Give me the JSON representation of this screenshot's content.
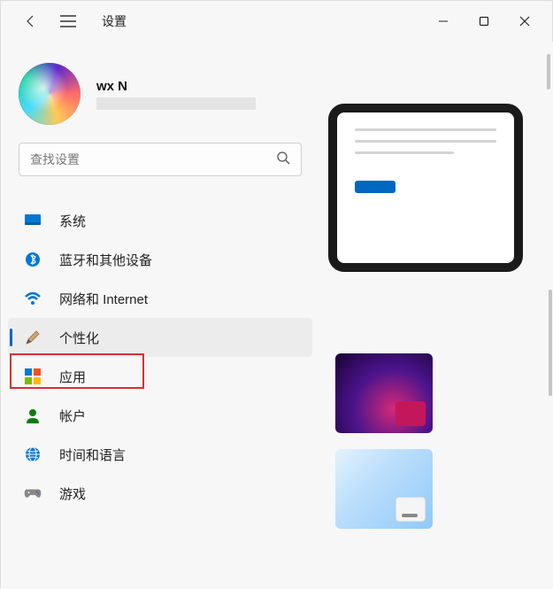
{
  "header": {
    "title": "设置"
  },
  "profile": {
    "name": "wx N"
  },
  "search": {
    "placeholder": "查找设置"
  },
  "nav": [
    {
      "id": "system",
      "label": "系统",
      "icon": "system-icon",
      "selected": false
    },
    {
      "id": "bluetooth",
      "label": "蓝牙和其他设备",
      "icon": "bluetooth-icon",
      "selected": false
    },
    {
      "id": "network",
      "label": "网络和 Internet",
      "icon": "wifi-icon",
      "selected": false
    },
    {
      "id": "personalization",
      "label": "个性化",
      "icon": "brush-icon",
      "selected": true
    },
    {
      "id": "apps",
      "label": "应用",
      "icon": "apps-icon",
      "selected": false
    },
    {
      "id": "accounts",
      "label": "帐户",
      "icon": "person-icon",
      "selected": false
    },
    {
      "id": "time",
      "label": "时间和语言",
      "icon": "globe-icon",
      "selected": false
    },
    {
      "id": "gaming",
      "label": "游戏",
      "icon": "gamepad-icon",
      "selected": false
    }
  ]
}
